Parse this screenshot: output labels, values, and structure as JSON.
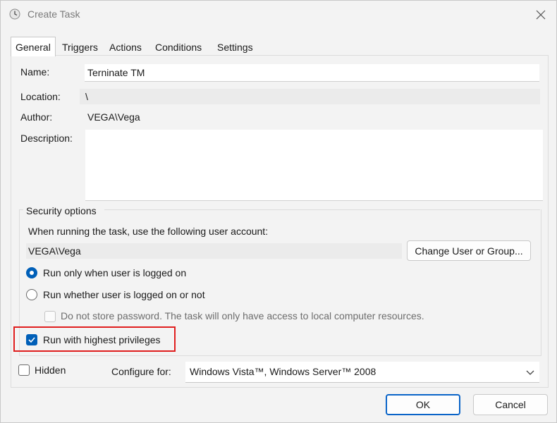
{
  "window": {
    "title": "Create Task"
  },
  "tabs": [
    {
      "label": "General"
    },
    {
      "label": "Triggers"
    },
    {
      "label": "Actions"
    },
    {
      "label": "Conditions"
    },
    {
      "label": "Settings"
    }
  ],
  "general": {
    "name_label": "Name:",
    "name_value": "Terninate TM",
    "location_label": "Location:",
    "location_value": "\\",
    "author_label": "Author:",
    "author_value": "VEGA\\Vega",
    "description_label": "Description:",
    "description_value": ""
  },
  "security": {
    "group_title": "Security options",
    "account_prompt": "When running the task, use the following user account:",
    "account_value": "VEGA\\Vega",
    "change_user_button": "Change User or Group...",
    "radio_logged_on": "Run only when user is logged on",
    "radio_whether": "Run whether user is logged on or not",
    "no_store_password": "Do not store password.  The task will only have access to local computer resources.",
    "highest_privileges": "Run with highest privileges"
  },
  "bottom": {
    "hidden_label": "Hidden",
    "configure_label": "Configure for:",
    "configure_value": "Windows Vista™, Windows Server™ 2008",
    "ok_button": "OK",
    "cancel_button": "Cancel"
  },
  "colors": {
    "accent": "#005fb8",
    "highlight_box": "#e01e1e"
  },
  "icons": {
    "title": "task-scheduler-clock-icon",
    "close": "close-icon",
    "combo": "chevron-down-icon"
  }
}
